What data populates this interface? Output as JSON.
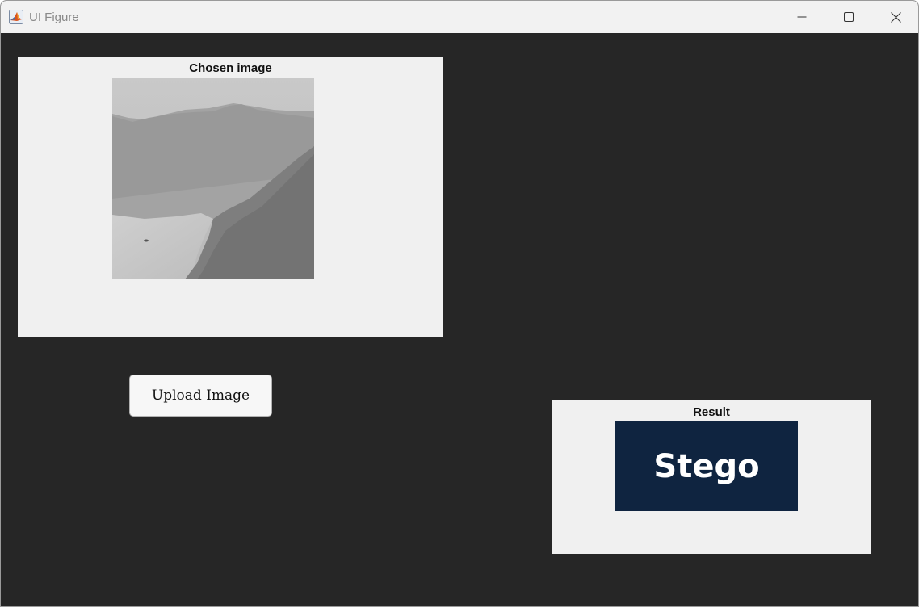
{
  "window": {
    "title": "UI Figure",
    "app_icon": "matlab-icon",
    "controls": {
      "minimize_icon": "minimize-icon",
      "maximize_icon": "maximize-icon",
      "close_icon": "close-icon"
    }
  },
  "chosen_panel": {
    "title": "Chosen image",
    "image_description_icon": "grayscale-landscape-image"
  },
  "upload_button": {
    "label": "Upload Image"
  },
  "result_panel": {
    "title": "Result",
    "result_text": "Stego"
  },
  "colors": {
    "background": "#262626",
    "panel": "#f0f0f0",
    "titlebar": "#f2f2f2",
    "stego_box": "#0f2440",
    "stego_text": "#ffffff"
  }
}
